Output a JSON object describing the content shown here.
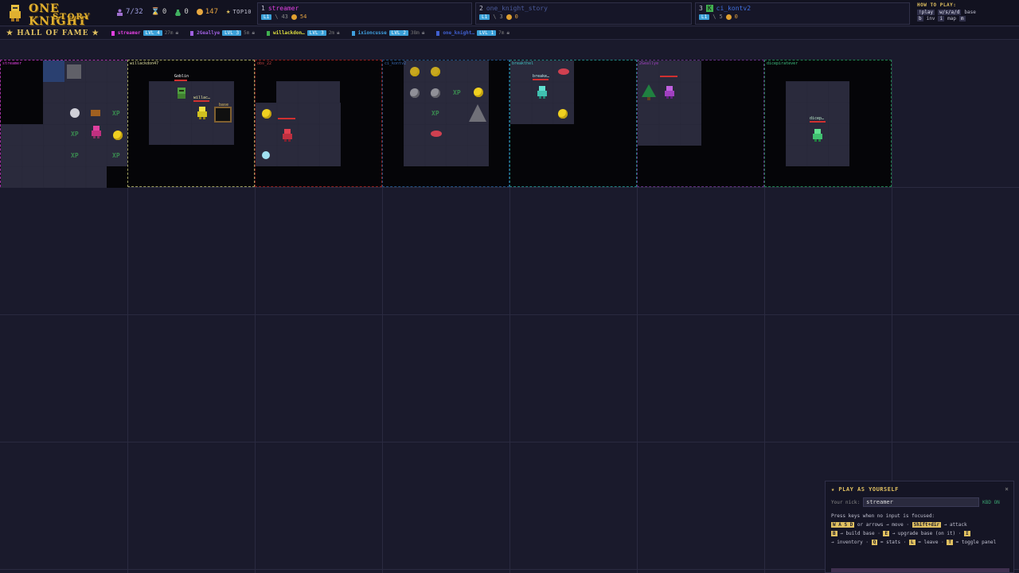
{
  "header": {
    "title_line1": "ONE KNIGHT",
    "title_line2": "STORY",
    "players": "7/32",
    "timer": "0",
    "kills": "0",
    "gold": "147",
    "top10": "TOP10"
  },
  "leaderboard": [
    {
      "rank": "1",
      "name": "streamer",
      "name_color": "#e040e0",
      "lvl": "L1",
      "kills": "43",
      "gold": "54"
    },
    {
      "rank": "2",
      "name": "one_knight_story",
      "name_color": "#4a5a9a",
      "lvl": "L1",
      "kills": "3",
      "gold": "0"
    },
    {
      "rank": "3",
      "prefix": "K",
      "name": "ci_kontv2",
      "name_color": "#4070e0",
      "lvl": "L1",
      "kills": "5",
      "gold": "0"
    }
  ],
  "howto": {
    "title": "HOW TO PLAY:",
    "rows": [
      {
        "k1": "!play",
        "k2": "w/s/a/d",
        "k3": "base"
      },
      {
        "k1": "b",
        "k2": "inv",
        "k3": "i",
        "k4": "map",
        "k5": "m"
      }
    ]
  },
  "hall_of_fame": {
    "title": "★ HALL OF FAME ★",
    "entries": [
      {
        "name": "streamer",
        "color": "#e040e0",
        "lvl": "LVL 4",
        "meta": "27m"
      },
      {
        "name": "2Geallye",
        "color": "#a060e0",
        "lvl": "LVL 3",
        "meta": "5m"
      },
      {
        "name": "willackdon…",
        "color": "#e0e040",
        "lvl": "LVL 3",
        "meta": "2m"
      },
      {
        "name": "ixioncusse",
        "color": "#40a0e0",
        "lvl": "LVL 2",
        "meta": "38m"
      },
      {
        "name": "one_knight…",
        "color": "#4060d0",
        "lvl": "LVL 1",
        "meta": "7m"
      }
    ]
  },
  "rooms": [
    {
      "label": "streamer",
      "label_color": "#e040e0"
    },
    {
      "label": "willackdon47",
      "label_color": "#e0e0a0"
    },
    {
      "label": "obs_22",
      "label_color": "#c04040"
    },
    {
      "label": "ci_kontv2",
      "label_color": "#3a6ab0"
    },
    {
      "label": "breakthel",
      "label_color": "#40c0c0"
    },
    {
      "label": "2Geallye",
      "label_color": "#a040c0"
    },
    {
      "label": "dicepiratever",
      "label_color": "#40c080"
    }
  ],
  "entities": {
    "goblin_label": "Goblin",
    "player_tags": {
      "willac": "willac…",
      "breake": "breake…",
      "dicep": "dicep…"
    },
    "base_tag": "base"
  },
  "play_panel": {
    "title": "★ PLAY AS YOURSELF",
    "close": "×",
    "nick_label": "Your nick:",
    "nick_value": "streamer",
    "kbd_status": "KBD ON",
    "help_intro": "Press keys when no input is focused:",
    "k_wasd": "W A S D",
    "t_move": "or arrows → move ·",
    "k_attack": "Shift+dir",
    "t_attack": "→ attack",
    "k_b": "B",
    "t_build": "→ build base ·",
    "k_e": "E",
    "t_upgrade": "→ upgrade base (on it) ·",
    "k_i": "I",
    "t_inv": "→ inventory ·",
    "k_q": "Q",
    "t_stats": "= stats ·",
    "k_l": "L",
    "t_leave": "= leave ·",
    "k_t": "T",
    "t_toggle": "= toggle panel"
  }
}
